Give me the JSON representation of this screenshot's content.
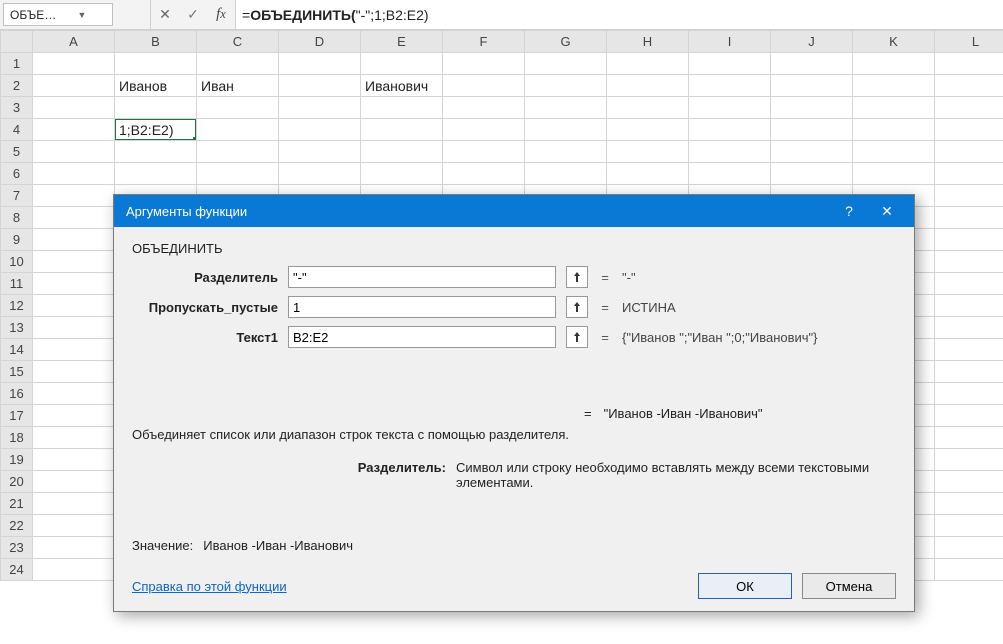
{
  "namebox": "ОБЪЕДИН...",
  "formula_prefix": "=",
  "formula_bold": "ОБЪЕДИНИТЬ(",
  "formula_rest": "\"-\";1;B2:E2)",
  "columns": [
    "A",
    "B",
    "C",
    "D",
    "E",
    "F",
    "G",
    "H",
    "I",
    "J",
    "K",
    "L"
  ],
  "rows": 24,
  "cells": {
    "B2": "Иванов",
    "C2": "Иван",
    "E2": "Иванович",
    "B4": "1;B2:E2)"
  },
  "active_cell": "B4",
  "dialog": {
    "title": "Аргументы функции",
    "fn_name": "ОБЪЕДИНИТЬ",
    "args": [
      {
        "label": "Разделитель",
        "value": "\"-\"",
        "result": "\"-\""
      },
      {
        "label": "Пропускать_пустые",
        "value": "1",
        "result": "ИСТИНА"
      },
      {
        "label": "Текст1",
        "value": "B2:E2",
        "result": "{\"Иванов \";\"Иван \";0;\"Иванович\"}"
      }
    ],
    "overall_result": "\"Иванов -Иван -Иванович\"",
    "description": "Объединяет список или диапазон строк текста с помощью разделителя.",
    "param_label": "Разделитель:",
    "param_text": "Символ или строку необходимо вставлять между всеми текстовыми элементами.",
    "result_label": "Значение:",
    "result_value": "Иванов -Иван -Иванович",
    "help": "Справка по этой функции",
    "ok": "ОК",
    "cancel": "Отмена"
  }
}
